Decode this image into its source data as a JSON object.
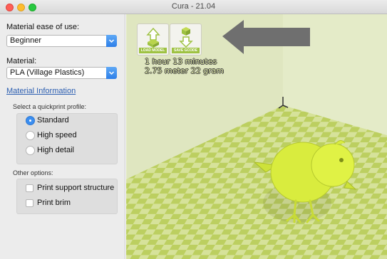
{
  "window": {
    "title": "Cura - 21.04"
  },
  "sidebar": {
    "ease_label": "Material ease of use:",
    "ease_value": "Beginner",
    "material_label": "Material:",
    "material_value": "PLA (Village Plastics)",
    "material_info_link": "Material Information",
    "quickprint": {
      "label": "Select a quickprint profile:",
      "options": [
        {
          "label": "Standard",
          "selected": true
        },
        {
          "label": "High speed",
          "selected": false
        },
        {
          "label": "High detail",
          "selected": false
        }
      ]
    },
    "other": {
      "label": "Other options:",
      "options": [
        {
          "label": "Print support structure",
          "checked": false
        },
        {
          "label": "Print brim",
          "checked": false
        }
      ]
    }
  },
  "viewport": {
    "load_model_label": "LOAD MODEL",
    "save_gcode_label": "SAVE GCODE",
    "print_time": "1 hour 13 minutes",
    "print_usage": "2.75 meter 22 gram"
  },
  "colors": {
    "bed_light": "#dfe8a8",
    "bed_dark": "#b9cc5e",
    "model": "#d9ec3e",
    "accent_blue": "#3b8ef0"
  }
}
